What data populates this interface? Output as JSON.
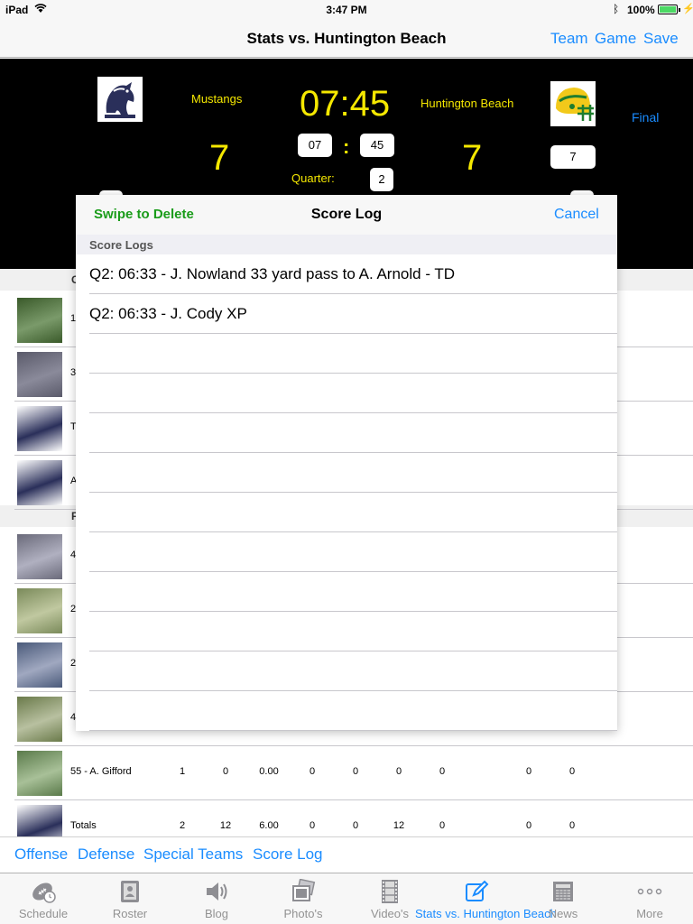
{
  "status_bar": {
    "carrier": "iPad",
    "time": "3:47 PM",
    "battery": "100%"
  },
  "nav": {
    "title": "Stats vs. Huntington Beach",
    "buttons": [
      "Team",
      "Game",
      "Save"
    ]
  },
  "scoreboard": {
    "home_name": "Mustangs",
    "away_name": "Huntington Beach",
    "clock": "07:45",
    "home_score": "7",
    "away_score": "7",
    "minutes": "07",
    "colon": ":",
    "seconds": "45",
    "quarter_label": "Quarter:",
    "quarter": "2",
    "away_box": "7",
    "final_label": "Final"
  },
  "background_rows": [
    {
      "label": "1",
      "stats": []
    },
    {
      "label": "3",
      "stats": []
    },
    {
      "label": "T",
      "stats": []
    },
    {
      "label": "A",
      "stats": []
    },
    {
      "label": "4",
      "stats": []
    },
    {
      "label": "2",
      "stats": []
    },
    {
      "label": "2",
      "stats": []
    },
    {
      "label": "4",
      "stats": []
    },
    {
      "label": "55 - A. Gifford",
      "stats": [
        "1",
        "0",
        "0.00",
        "0",
        "0",
        "0",
        "0",
        "",
        "0",
        "0"
      ]
    },
    {
      "label": "Totals",
      "stats": [
        "2",
        "12",
        "6.00",
        "0",
        "0",
        "12",
        "0",
        "",
        "0",
        "0"
      ]
    }
  ],
  "section_letters": [
    "C",
    "F"
  ],
  "modal": {
    "left_action": "Swipe to Delete",
    "title": "Score Log",
    "right_action": "Cancel",
    "section_header": "Score Logs",
    "entries": [
      "Q2: 06:33 - J. Nowland 33 yard pass to A. Arnold - TD",
      "Q2: 06:33 - J. Cody XP"
    ]
  },
  "segment_links": [
    "Offense",
    "Defense",
    "Special Teams",
    "Score Log"
  ],
  "tabs": [
    {
      "label": "Schedule",
      "icon": "football-clock-icon",
      "active": false
    },
    {
      "label": "Roster",
      "icon": "roster-book-icon",
      "active": false
    },
    {
      "label": "Blog",
      "icon": "speaker-icon",
      "active": false
    },
    {
      "label": "Photo's",
      "icon": "photos-icon",
      "active": false
    },
    {
      "label": "Video's",
      "icon": "film-icon",
      "active": false
    },
    {
      "label": "Stats vs. Huntington Beach",
      "icon": "edit-icon",
      "active": true
    },
    {
      "label": "News",
      "icon": "newspaper-icon",
      "active": false
    },
    {
      "label": "More",
      "icon": "more-dots-icon",
      "active": false
    }
  ],
  "colors": {
    "accent": "#1a8cff",
    "score_yellow": "#f5e800",
    "swipe_green": "#1a9c1a",
    "scoreboard_bg": "#000000"
  }
}
